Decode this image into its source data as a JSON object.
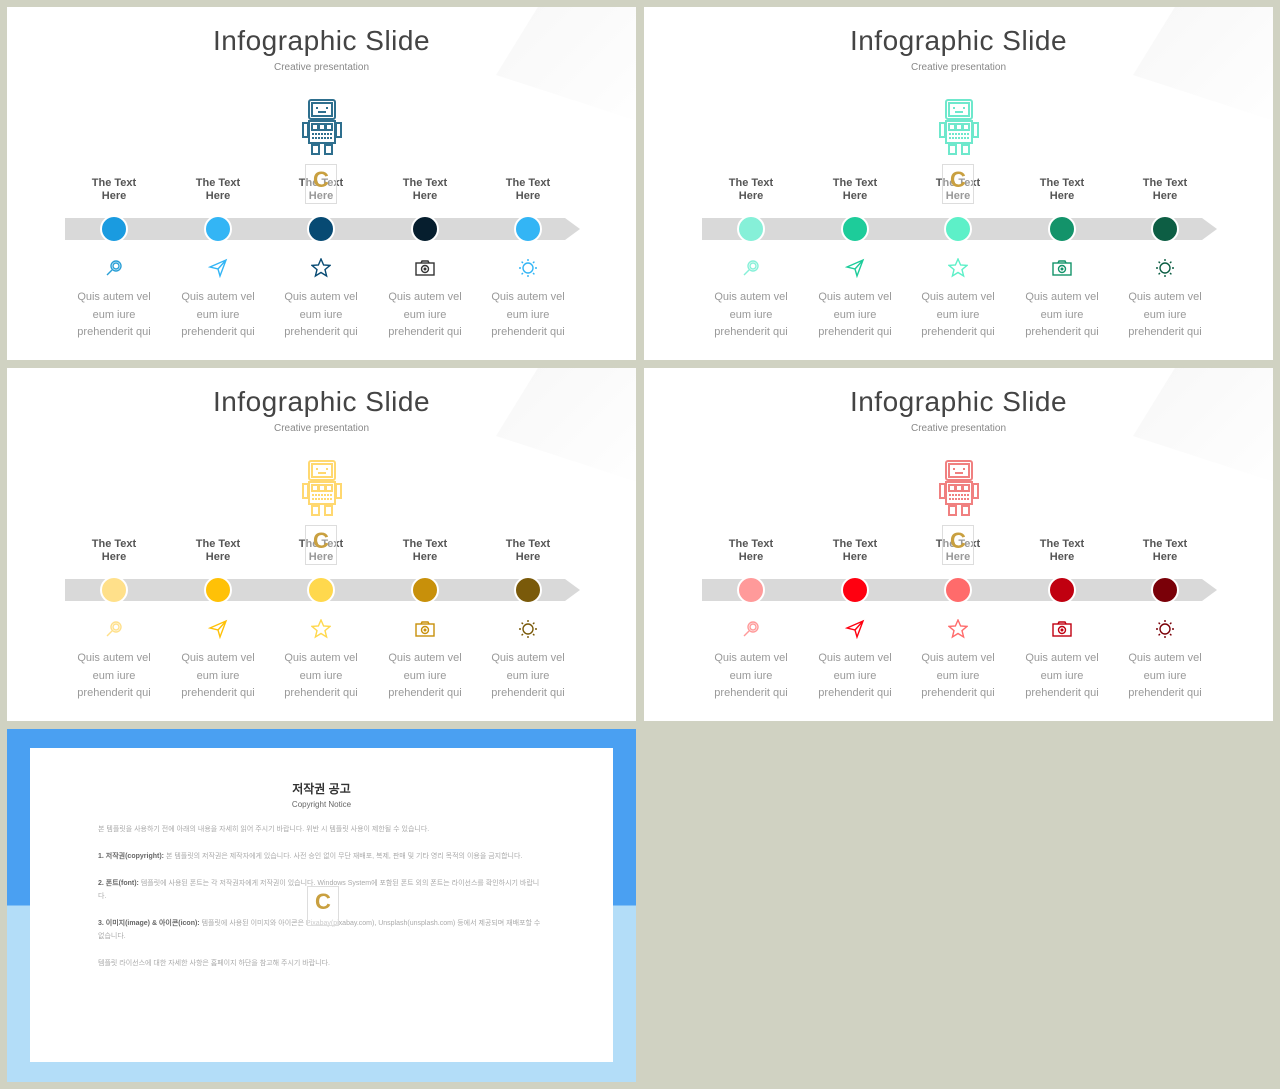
{
  "slide_title": "Infographic Slide",
  "slide_subtitle": "Creative presentation",
  "item_label": [
    "The Text",
    "Here"
  ],
  "item_desc": [
    "Quis autem vel",
    "eum iure",
    "prehenderit qui"
  ],
  "watermark": "C",
  "icons": [
    "magnifier-icon",
    "paper-plane-icon",
    "star-icon",
    "camera-icon",
    "sun-icon"
  ],
  "slides": [
    {
      "robot_color": "#2e6f8e",
      "dots": [
        "#1a9be0",
        "#33b5f5",
        "#074a73",
        "#061e2e",
        "#33b5f5"
      ],
      "icon_colors": [
        "#2a9fd6",
        "#33b5f5",
        "#074a73",
        "#333333",
        "#33b5f5"
      ]
    },
    {
      "robot_color": "#6ee8cc",
      "dots": [
        "#86f0d8",
        "#1dcc9a",
        "#5df0c8",
        "#13936a",
        "#0d5e44"
      ],
      "icon_colors": [
        "#86f0d8",
        "#1dcc9a",
        "#5df0c8",
        "#13936a",
        "#0d5e44"
      ]
    },
    {
      "robot_color": "#ffd870",
      "dots": [
        "#ffe08a",
        "#ffc107",
        "#ffd84d",
        "#c8900a",
        "#7a5a0a"
      ],
      "icon_colors": [
        "#ffe08a",
        "#ffc107",
        "#ffd84d",
        "#c8900a",
        "#7a5a0a"
      ]
    },
    {
      "robot_color": "#f08080",
      "dots": [
        "#ff9a9a",
        "#ff0010",
        "#ff6b6b",
        "#c00010",
        "#7a0008"
      ],
      "icon_colors": [
        "#ff9a9a",
        "#ff0010",
        "#ff6b6b",
        "#c00010",
        "#7a0008"
      ]
    }
  ],
  "copyright": {
    "title": "저작권 공고",
    "subtitle": "Copyright Notice",
    "paras": [
      {
        "head": "",
        "body": "본 템플릿을 사용하기 전에 아래의 내용을 자세히 읽어 주시기 바랍니다. 위반 시 템플릿 사용이 제한될 수 있습니다."
      },
      {
        "head": "1. 저작권(copyright):",
        "body": "본 템플릿의 저작권은 제작자에게 있습니다. 사전 승인 없이 무단 재배포, 복제, 판매 및 기타 영리 목적의 이용을 금지합니다."
      },
      {
        "head": "2. 폰트(font):",
        "body": "템플릿에 사용된 폰트는 각 저작권자에게 저작권이 있습니다. Windows System에 포함된 폰트 외의 폰트는 라이선스를 확인하시기 바랍니다."
      },
      {
        "head": "3. 이미지(image) & 아이콘(icon):",
        "body": "템플릿에 사용된 이미지와 아이콘은 Pixabay(pixabay.com), Unsplash(unsplash.com) 등에서 제공되며 재배포할 수 없습니다."
      },
      {
        "head": "",
        "body": "템플릿 라이선스에 대한 자세한 사항은 홈페이지 하단을 참고해 주시기 바랍니다."
      }
    ]
  }
}
